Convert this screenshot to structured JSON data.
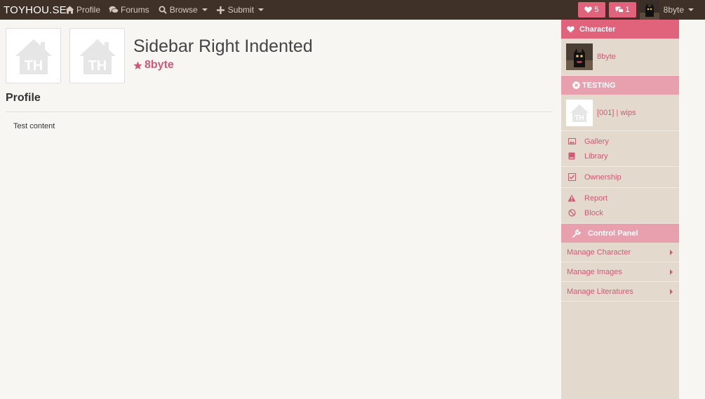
{
  "navbar": {
    "brand": "TOYHOU.SE",
    "links": [
      {
        "label": "Profile",
        "icon": "home-icon",
        "dropdown": false
      },
      {
        "label": "Forums",
        "icon": "comments-icon",
        "dropdown": false
      },
      {
        "label": "Browse",
        "icon": "search-icon",
        "dropdown": true
      },
      {
        "label": "Submit",
        "icon": "plus-icon",
        "dropdown": true
      }
    ],
    "favorites_count": "5",
    "messages_count": "1",
    "username": "8byte"
  },
  "main": {
    "title": "Sidebar Right Indented",
    "owner": "8byte",
    "section_title": "Profile",
    "content_text": "Test content"
  },
  "sidebar": {
    "character_header": "Character",
    "character_name": "8byte",
    "folder_header": "TESTING",
    "wip_label": "[001] | wips",
    "links": {
      "gallery": "Gallery",
      "library": "Library",
      "ownership": "Ownership",
      "report": "Report",
      "block": "Block"
    },
    "control_panel_header": "Control Panel",
    "control_items": [
      "Manage Character",
      "Manage Images",
      "Manage Literatures"
    ]
  },
  "colors": {
    "nav_bg": "#3f3127",
    "accent": "#e0637b",
    "accent_soft": "#e8a0ae",
    "link_pink": "#d05a75",
    "sidebar_bg": "#e3d9cc",
    "page_bg": "#f8f6f2"
  }
}
